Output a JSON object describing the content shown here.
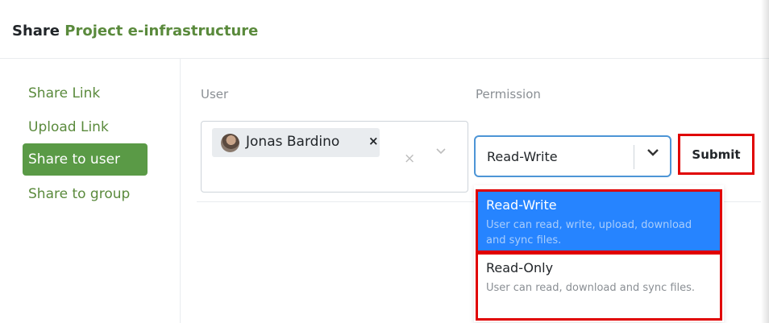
{
  "dialog": {
    "title_prefix": "Share",
    "project_name": "Project e-infrastructure"
  },
  "nav": {
    "items": [
      {
        "label": "Share Link"
      },
      {
        "label": "Upload Link"
      },
      {
        "label": "Share to user"
      },
      {
        "label": "Share to group"
      }
    ],
    "active": "Share to user"
  },
  "form": {
    "user_label": "User",
    "permission_label": "Permission",
    "selected_user": "Jonas Bardino",
    "chip_remove": "×",
    "clear_icon": "×",
    "dropdown_icon": "chevron-down-icon",
    "permission_value": "Read-Write",
    "submit_label": "Submit"
  },
  "permission_options": [
    {
      "title": "Read-Write",
      "description": "User can read, write, upload, download and sync files."
    },
    {
      "title": "Read-Only",
      "description": "User can read, download and sync files."
    }
  ],
  "colors": {
    "accent_green": "#5a9a46",
    "option_highlight": "#2684ff",
    "focus_border": "#4d95d6",
    "annotation_red": "#e00000"
  }
}
